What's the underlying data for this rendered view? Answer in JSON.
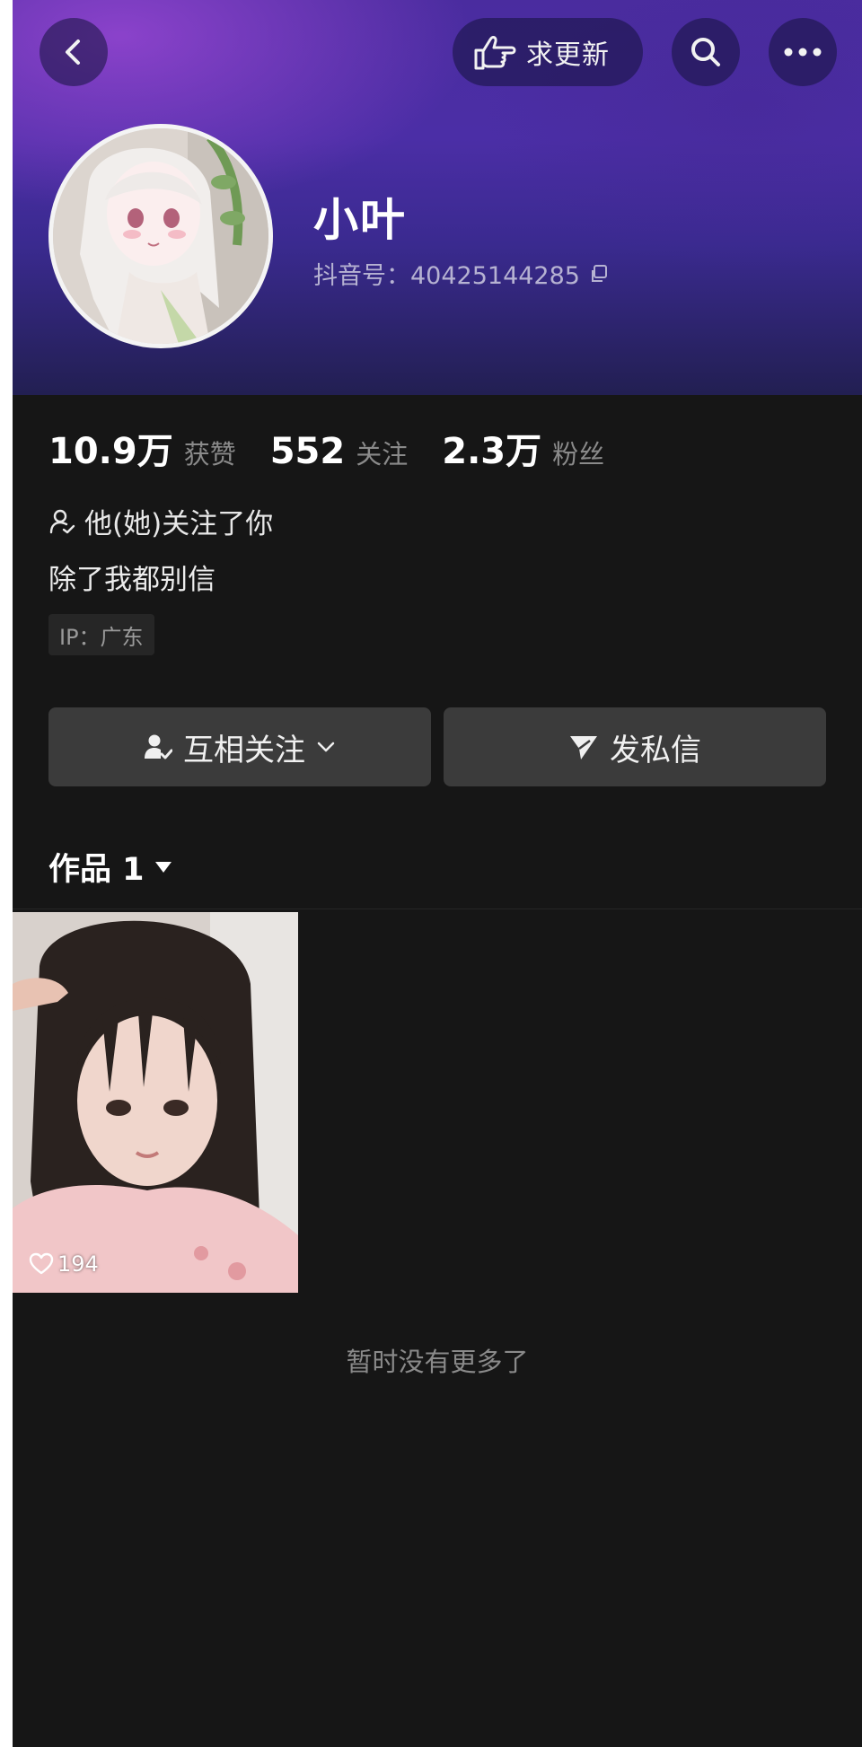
{
  "header": {
    "request_update_label": "求更新"
  },
  "profile": {
    "name": "小叶",
    "douyin_id": "抖音号：40425144285"
  },
  "stats": [
    {
      "value": "10.9万",
      "label": "获赞"
    },
    {
      "value": "552",
      "label": "关注"
    },
    {
      "value": "2.3万",
      "label": "粉丝"
    }
  ],
  "relation_note": "他(她)关注了你",
  "bio": "除了我都别信",
  "ip_location": "IP：广东",
  "actions": {
    "follow_label": "互相关注",
    "message_label": "发私信"
  },
  "works": {
    "tab_label": "作品 1",
    "items": [
      {
        "likes": "194"
      }
    ],
    "end_text": "暂时没有更多了"
  },
  "colors": {
    "background": "#161616",
    "header_purple": "#4a2c9f",
    "button_gray": "#3b3b3b"
  },
  "icons": [
    "back-arrow-icon",
    "pointing-hand-icon",
    "search-icon",
    "more-dots-icon",
    "copy-icon",
    "user-check-icon",
    "user-follow-icon",
    "chevron-down-icon",
    "send-icon",
    "triangle-down-icon",
    "heart-icon"
  ]
}
